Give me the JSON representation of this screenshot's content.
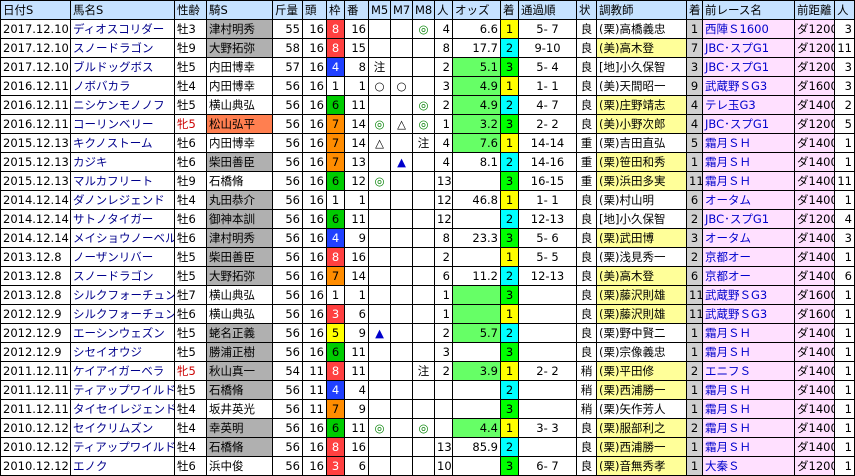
{
  "headers": [
    "日付S",
    "馬名S",
    "性齢",
    "騎S",
    "斤量",
    "頭",
    "枠",
    "番",
    "M5",
    "M7",
    "M8",
    "人",
    "オッズ",
    "着",
    "通過順",
    "状",
    "調教師",
    "着",
    "前レース名",
    "前距離",
    "人"
  ],
  "rows": [
    {
      "date": "2017.12.10",
      "horse": "ディオスコリダー",
      "sex": "牡3",
      "jockey": "津村明秀",
      "jk": "gray",
      "kin": "55",
      "heads": "16",
      "waku": "8",
      "wc": "b3",
      "ban": "16",
      "m5": "",
      "m7": "",
      "m8": "◎",
      "pop": "4",
      "odds": "6.6",
      "oddsbg": "odds-w",
      "rank": "1",
      "rc": "r-1",
      "pass": "5- 7",
      "cond": "良",
      "trainer": "(栗)高橋義忠",
      "tr": "",
      "fr": "1",
      "frc": "fr",
      "prev": "西陣Ｓ1600",
      "pd": "ダ1200",
      "pp": "3"
    },
    {
      "date": "2017.12.10",
      "horse": "スノードラゴン",
      "sex": "牡9",
      "jockey": "大野拓弥",
      "jk": "gray",
      "kin": "58",
      "heads": "16",
      "waku": "8",
      "wc": "b3",
      "ban": "15",
      "m5": "",
      "m7": "",
      "m8": "",
      "pop": "8",
      "odds": "17.7",
      "oddsbg": "odds-w",
      "rank": "2",
      "rc": "r-1",
      "pass": "9-10",
      "cond": "良",
      "trainer": "(美)高木登",
      "tr": "t-ritto",
      "fr": "7",
      "frc": "fr",
      "prev": "JBC･スプG1",
      "pd": "ダ1200",
      "pp": "11"
    },
    {
      "date": "2017.12.10",
      "horse": "ブルドッグボス",
      "sex": "牡5",
      "jockey": "内田博幸",
      "jk": "",
      "kin": "57",
      "heads": "16",
      "waku": "4",
      "wc": "b4",
      "ban": "8",
      "m5": "注",
      "m7": "",
      "m8": "",
      "pop": "2",
      "odds": "5.1",
      "oddsbg": "odds-g",
      "rank": "3",
      "rc": "r-1",
      "pass": "5- 4",
      "cond": "良",
      "trainer": "[地]小久保智",
      "tr": "",
      "fr": "3",
      "frc": "fr",
      "prev": "JBC･スプG1",
      "pd": "ダ1200",
      "pp": "3"
    },
    {
      "date": "2016.12.11",
      "horse": "ノボバカラ",
      "sex": "牡4",
      "jockey": "内田博幸",
      "jk": "",
      "kin": "56",
      "heads": "16",
      "waku": "1",
      "wc": "b1",
      "ban": "1",
      "m5": "○",
      "m7": "○",
      "m8": "",
      "pop": "3",
      "odds": "4.9",
      "oddsbg": "odds-g",
      "rank": "1",
      "rc": "r-1",
      "pass": "1- 1",
      "cond": "良",
      "trainer": "(美)天間昭一",
      "tr": "",
      "fr": "9",
      "frc": "fr",
      "prev": "武蔵野ＳG3",
      "pd": "ダ1600",
      "pp": "3"
    },
    {
      "date": "2016.12.11",
      "horse": "ニシケンモノノフ",
      "sex": "牡5",
      "jockey": "横山典弘",
      "jk": "",
      "kin": "56",
      "heads": "16",
      "waku": "6",
      "wc": "b6",
      "ban": "11",
      "m5": "",
      "m7": "",
      "m8": "◎",
      "pop": "2",
      "odds": "4.9",
      "oddsbg": "odds-g",
      "rank": "2",
      "rc": "r-1",
      "pass": "4- 7",
      "cond": "良",
      "trainer": "(栗)庄野靖志",
      "tr": "t-ritto",
      "fr": "4",
      "frc": "fr",
      "prev": "テレ玉G3",
      "pd": "ダ1400",
      "pp": "2"
    },
    {
      "date": "2016.12.11",
      "horse": "コーリンベリー",
      "sex": "牝5",
      "jockey": "松山弘平",
      "jk": "orange",
      "kin": "56",
      "heads": "16",
      "waku": "7",
      "wc": "b7",
      "ban": "14",
      "m5": "◎",
      "m7": "△",
      "m8": "◎",
      "pop": "1",
      "odds": "3.2",
      "oddsbg": "odds-g",
      "rank": "3",
      "rc": "r-1",
      "pass": "2- 2",
      "cond": "良",
      "trainer": "(美)小野次郎",
      "tr": "t-ritto",
      "fr": "4",
      "frc": "fr",
      "prev": "JBC･スプG1",
      "pd": "ダ1200",
      "pp": "5"
    },
    {
      "date": "2015.12.13",
      "horse": "キクノストーム",
      "sex": "牡6",
      "jockey": "内田博幸",
      "jk": "",
      "kin": "56",
      "heads": "16",
      "waku": "7",
      "wc": "b7",
      "ban": "14",
      "m5": "△",
      "m7": "",
      "m8": "注",
      "pop": "4",
      "odds": "7.6",
      "oddsbg": "odds-g",
      "rank": "1",
      "rc": "r-1",
      "pass": "14-14",
      "cond": "重",
      "trainer": "(栗)吉田直弘",
      "tr": "",
      "fr": "5",
      "frc": "fr",
      "prev": "霜月ＳＨ",
      "pd": "ダ1400",
      "pp": "1"
    },
    {
      "date": "2015.12.13",
      "horse": "カジキ",
      "sex": "牡6",
      "jockey": "柴田善臣",
      "jk": "gray",
      "kin": "56",
      "heads": "16",
      "waku": "7",
      "wc": "b7",
      "ban": "13",
      "m5": "",
      "m7": "▲",
      "m8": "",
      "pop": "4",
      "odds": "8.1",
      "oddsbg": "odds-w",
      "rank": "2",
      "rc": "r-1",
      "pass": "14-16",
      "cond": "重",
      "trainer": "(栗)笹田和秀",
      "tr": "t-ritto",
      "fr": "1",
      "frc": "fr",
      "prev": "霜月ＳＨ",
      "pd": "ダ1400",
      "pp": "1"
    },
    {
      "date": "2015.12.13",
      "horse": "マルカフリート",
      "sex": "牡9",
      "jockey": "石橋脩",
      "jk": "",
      "kin": "56",
      "heads": "16",
      "waku": "6",
      "wc": "b6",
      "ban": "12",
      "m5": "◎",
      "m7": "",
      "m8": "",
      "pop": "13",
      "odds": "",
      "oddsbg": "odds-w",
      "rank": "3",
      "rc": "r-1",
      "pass": "16-15",
      "cond": "重",
      "trainer": "(栗)浜田多実",
      "tr": "t-ritto",
      "fr": "11",
      "frc": "fr",
      "prev": "霜月ＳＨ",
      "pd": "ダ1400",
      "pp": "11"
    },
    {
      "date": "2014.12.14",
      "horse": "ダノンレジェンド",
      "sex": "牡4",
      "jockey": "丸田恭介",
      "jk": "gray",
      "kin": "56",
      "heads": "16",
      "waku": "1",
      "wc": "b1",
      "ban": "1",
      "m5": "",
      "m7": "",
      "m8": "",
      "pop": "12",
      "odds": "46.8",
      "oddsbg": "odds-w",
      "rank": "1",
      "rc": "r-1",
      "pass": "1- 1",
      "cond": "良",
      "trainer": "(栗)村山明",
      "tr": "",
      "fr": "6",
      "frc": "fr",
      "prev": "オータム",
      "pd": "ダ1400",
      "pp": "1"
    },
    {
      "date": "2014.12.14",
      "horse": "サトノタイガー",
      "sex": "牡6",
      "jockey": "御神本訓",
      "jk": "gray",
      "kin": "56",
      "heads": "16",
      "waku": "6",
      "wc": "b6",
      "ban": "11",
      "m5": "",
      "m7": "",
      "m8": "",
      "pop": "12",
      "odds": "",
      "oddsbg": "odds-w",
      "rank": "2",
      "rc": "r-1",
      "pass": "12-13",
      "cond": "良",
      "trainer": "[地]小久保智",
      "tr": "",
      "fr": "2",
      "frc": "fr",
      "prev": "JBC･スプG1",
      "pd": "ダ1200",
      "pp": "4"
    },
    {
      "date": "2014.12.14",
      "horse": "メイショウノーベル",
      "sex": "牡6",
      "jockey": "津村明秀",
      "jk": "gray",
      "kin": "56",
      "heads": "16",
      "waku": "4",
      "wc": "b4",
      "ban": "9",
      "m5": "",
      "m7": "",
      "m8": "",
      "pop": "8",
      "odds": "23.3",
      "oddsbg": "odds-w",
      "rank": "3",
      "rc": "r-1",
      "pass": "5- 6",
      "cond": "良",
      "trainer": "(栗)武田博",
      "tr": "t-ritto",
      "fr": "3",
      "frc": "fr",
      "prev": "オータム",
      "pd": "ダ1400",
      "pp": "3"
    },
    {
      "date": "2013.12.8",
      "horse": "ノーザンリバー",
      "sex": "牡5",
      "jockey": "柴田善臣",
      "jk": "gray",
      "kin": "56",
      "heads": "16",
      "waku": "8",
      "wc": "b3",
      "ban": "16",
      "m5": "",
      "m7": "",
      "m8": "",
      "pop": "2",
      "odds": "",
      "oddsbg": "odds-w",
      "rank": "1",
      "rc": "r-1",
      "pass": "5- 5",
      "cond": "良",
      "trainer": "(栗)浅見秀一",
      "tr": "",
      "fr": "2",
      "frc": "fr",
      "prev": "京都オー",
      "pd": "ダ1400",
      "pp": "1"
    },
    {
      "date": "2013.12.8",
      "horse": "スノードラゴン",
      "sex": "牡5",
      "jockey": "大野拓弥",
      "jk": "gray",
      "kin": "56",
      "heads": "16",
      "waku": "7",
      "wc": "b7",
      "ban": "14",
      "m5": "",
      "m7": "",
      "m8": "",
      "pop": "6",
      "odds": "11.2",
      "oddsbg": "odds-w",
      "rank": "2",
      "rc": "r-1",
      "pass": "12-13",
      "cond": "良",
      "trainer": "(美)高木登",
      "tr": "t-ritto",
      "fr": "6",
      "frc": "fr",
      "prev": "京都オー",
      "pd": "ダ1400",
      "pp": "6"
    },
    {
      "date": "2013.12.8",
      "horse": "シルクフォーチュン",
      "sex": "牡7",
      "jockey": "横山典弘",
      "jk": "",
      "kin": "56",
      "heads": "16",
      "waku": "1",
      "wc": "b1",
      "ban": "1",
      "m5": "",
      "m7": "",
      "m8": "",
      "pop": "1",
      "odds": "",
      "oddsbg": "odds-g",
      "rank": "3",
      "rc": "r-1",
      "pass": "",
      "cond": "良",
      "trainer": "(栗)藤沢則雄",
      "tr": "t-ritto",
      "fr": "11",
      "frc": "fr",
      "prev": "武蔵野ＳG3",
      "pd": "ダ1600",
      "pp": "1"
    },
    {
      "date": "2012.12.9",
      "horse": "シルクフォーチュン",
      "sex": "牡6",
      "jockey": "横山典弘",
      "jk": "",
      "kin": "56",
      "heads": "16",
      "waku": "3",
      "wc": "b3",
      "ban": "6",
      "m5": "",
      "m7": "",
      "m8": "",
      "pop": "1",
      "odds": "",
      "oddsbg": "odds-g",
      "rank": "1",
      "rc": "r-1",
      "pass": "",
      "cond": "良",
      "trainer": "(栗)藤沢則雄",
      "tr": "t-ritto",
      "fr": "11",
      "frc": "fr",
      "prev": "武蔵野ＳG3",
      "pd": "ダ1600",
      "pp": "1"
    },
    {
      "date": "2012.12.9",
      "horse": "エーシンウェズン",
      "sex": "牡5",
      "jockey": "蛯名正義",
      "jk": "gray",
      "kin": "56",
      "heads": "16",
      "waku": "5",
      "wc": "b5",
      "ban": "9",
      "m5": "▲",
      "m7": "",
      "m8": "",
      "pop": "2",
      "odds": "5.7",
      "oddsbg": "odds-g",
      "rank": "2",
      "rc": "r-1",
      "pass": "",
      "cond": "良",
      "trainer": "(栗)野中賢二",
      "tr": "",
      "fr": "1",
      "frc": "fr",
      "prev": "霜月ＳＨ",
      "pd": "ダ1400",
      "pp": "1"
    },
    {
      "date": "2012.12.9",
      "horse": "シセイオウジ",
      "sex": "牡5",
      "jockey": "勝浦正樹",
      "jk": "gray",
      "kin": "56",
      "heads": "16",
      "waku": "6",
      "wc": "b6",
      "ban": "11",
      "m5": "",
      "m7": "",
      "m8": "",
      "pop": "3",
      "odds": "",
      "oddsbg": "odds-w",
      "rank": "3",
      "rc": "r-1",
      "pass": "",
      "cond": "良",
      "trainer": "(栗)宗像義忠",
      "tr": "",
      "fr": "1",
      "frc": "fr",
      "prev": "霜月ＳＨ",
      "pd": "ダ1400",
      "pp": "1"
    },
    {
      "date": "2011.12.11",
      "horse": "ケイアイガーベラ",
      "sex": "牝5",
      "jockey": "秋山真一",
      "jk": "gray",
      "kin": "54",
      "heads": "11",
      "waku": "8",
      "wc": "b3",
      "ban": "11",
      "m5": "",
      "m7": "",
      "m8": "注",
      "pop": "2",
      "odds": "3.9",
      "oddsbg": "odds-g",
      "rank": "1",
      "rc": "r-1",
      "pass": "2- 2",
      "cond": "稍",
      "trainer": "(栗)平田修",
      "tr": "t-ritto",
      "fr": "2",
      "frc": "fr",
      "prev": "エニフＳ",
      "pd": "ダ1400",
      "pp": "1"
    },
    {
      "date": "2011.12.11",
      "horse": "ティアップワイルド",
      "sex": "牡5",
      "jockey": "石橋脩",
      "jk": "gray",
      "kin": "56",
      "heads": "11",
      "waku": "4",
      "wc": "b4",
      "ban": "4",
      "m5": "",
      "m7": "",
      "m8": "",
      "pop": "",
      "odds": "",
      "oddsbg": "odds-w",
      "rank": "2",
      "rc": "r-1",
      "pass": "",
      "cond": "稍",
      "trainer": "(栗)西浦勝一",
      "tr": "t-ritto",
      "fr": "1",
      "frc": "fr",
      "prev": "霜月ＳＨ",
      "pd": "ダ1400",
      "pp": "1"
    },
    {
      "date": "2011.12.11",
      "horse": "タイセイレジェンド",
      "sex": "牡4",
      "jockey": "坂井英光",
      "jk": "",
      "kin": "56",
      "heads": "11",
      "waku": "7",
      "wc": "b7",
      "ban": "9",
      "m5": "",
      "m7": "",
      "m8": "",
      "pop": "",
      "odds": "",
      "oddsbg": "odds-w",
      "rank": "3",
      "rc": "r-1",
      "pass": "",
      "cond": "稍",
      "trainer": "(栗)矢作芳人",
      "tr": "",
      "fr": "1",
      "frc": "fr",
      "prev": "霜月ＳＨ",
      "pd": "ダ1400",
      "pp": "1"
    },
    {
      "date": "2010.12.12",
      "horse": "セイクリムズン",
      "sex": "牡4",
      "jockey": "幸英明",
      "jk": "gray",
      "kin": "56",
      "heads": "16",
      "waku": "6",
      "wc": "b6",
      "ban": "11",
      "m5": "◎",
      "m7": "",
      "m8": "◎",
      "pop": "",
      "odds": "4.4",
      "oddsbg": "odds-g",
      "rank": "1",
      "rc": "r-1",
      "pass": "3- 3",
      "cond": "良",
      "trainer": "(栗)服部利之",
      "tr": "t-ritto",
      "fr": "2",
      "frc": "fr",
      "prev": "霜月ＳＨ",
      "pd": "ダ1400",
      "pp": "1"
    },
    {
      "date": "2010.12.12",
      "horse": "ティアップワイルド",
      "sex": "牡4",
      "jockey": "石橋脩",
      "jk": "gray",
      "kin": "56",
      "heads": "16",
      "waku": "8",
      "wc": "b3",
      "ban": "16",
      "m5": "",
      "m7": "",
      "m8": "",
      "pop": "13",
      "odds": "85.9",
      "oddsbg": "odds-w",
      "rank": "2",
      "rc": "r-1",
      "pass": "",
      "cond": "良",
      "trainer": "(栗)西浦勝一",
      "tr": "t-ritto",
      "fr": "1",
      "frc": "fr",
      "prev": "霜月ＳＨ",
      "pd": "ダ1400",
      "pp": "1"
    },
    {
      "date": "2010.12.12",
      "horse": "エノク",
      "sex": "牡6",
      "jockey": "浜中俊",
      "jk": "",
      "kin": "56",
      "heads": "16",
      "waku": "3",
      "wc": "b3",
      "ban": "6",
      "m5": "",
      "m7": "",
      "m8": "",
      "pop": "10",
      "odds": "",
      "oddsbg": "odds-w",
      "rank": "3",
      "rc": "r-1",
      "pass": "6- 7",
      "cond": "良",
      "trainer": "(栗)音無秀孝",
      "tr": "t-ritto",
      "fr": "1",
      "frc": "fr",
      "prev": "大秦Ｓ",
      "pd": "ダ1200",
      "pp": "1"
    }
  ]
}
